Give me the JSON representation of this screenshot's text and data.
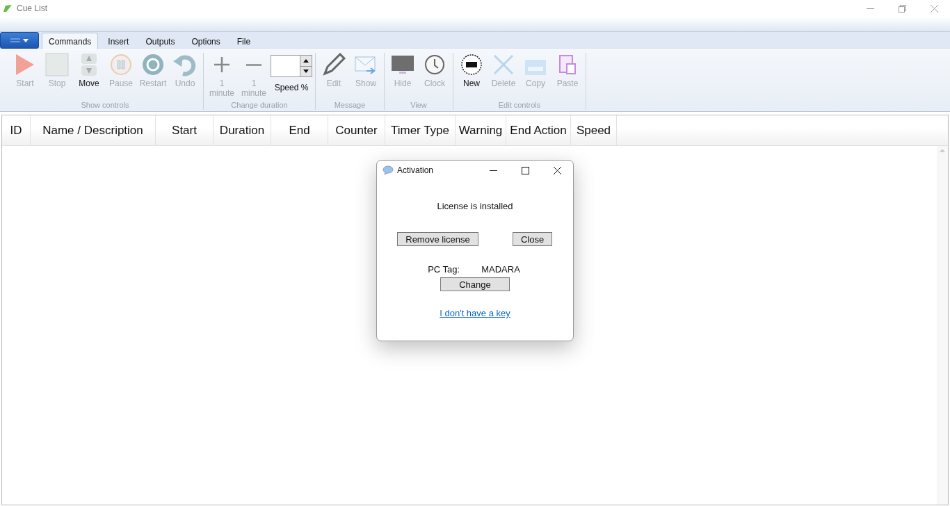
{
  "window": {
    "title": "Cue List"
  },
  "tabs": [
    {
      "label": "Commands",
      "selected": true
    },
    {
      "label": "Insert",
      "selected": false
    },
    {
      "label": "Outputs",
      "selected": false
    },
    {
      "label": "Options",
      "selected": false
    },
    {
      "label": "File",
      "selected": false
    }
  ],
  "ribbon": [
    {
      "label": "Show controls",
      "items": [
        {
          "kind": "start",
          "label": "Start",
          "disabled": true
        },
        {
          "kind": "stop",
          "label": "Stop",
          "disabled": true
        },
        {
          "kind": "move",
          "label": "Move",
          "disabled": false
        },
        {
          "kind": "pause",
          "label": "Pause",
          "disabled": true
        },
        {
          "kind": "restart",
          "label": "Restart",
          "disabled": true
        },
        {
          "kind": "undo",
          "label": "Undo",
          "disabled": true
        }
      ]
    },
    {
      "label": "Change duration",
      "items": [
        {
          "kind": "plus",
          "label": "1 minute",
          "disabled": true
        },
        {
          "kind": "minus",
          "label": "1 minute",
          "disabled": true
        },
        {
          "kind": "spinner",
          "label": "Speed %",
          "disabled": false
        }
      ]
    },
    {
      "label": "Message",
      "items": [
        {
          "kind": "edit",
          "label": "Edit",
          "disabled": true
        },
        {
          "kind": "show",
          "label": "Show",
          "disabled": true
        }
      ]
    },
    {
      "label": "View",
      "items": [
        {
          "kind": "hide",
          "label": "Hide",
          "disabled": true
        },
        {
          "kind": "clock",
          "label": "Clock",
          "disabled": true
        }
      ]
    },
    {
      "label": "Edit controls",
      "items": [
        {
          "kind": "new",
          "label": "New",
          "disabled": false
        },
        {
          "kind": "delete",
          "label": "Delete",
          "disabled": true
        },
        {
          "kind": "copy",
          "label": "Copy",
          "disabled": true
        },
        {
          "kind": "paste",
          "label": "Paste",
          "disabled": true
        }
      ]
    }
  ],
  "table": {
    "columns": [
      "ID",
      "Name / Description",
      "Start",
      "Duration",
      "End",
      "Counter",
      "Timer Type",
      "Warning",
      "End Action",
      "Speed"
    ]
  },
  "dialog": {
    "title": "Activation",
    "message": "License is installed",
    "buttons": [
      "Remove license",
      "Close"
    ],
    "pc_tag_label": "PC Tag:",
    "pc_tag_value": "MADARA",
    "change_button": "Change",
    "link": "I don't have a key"
  }
}
